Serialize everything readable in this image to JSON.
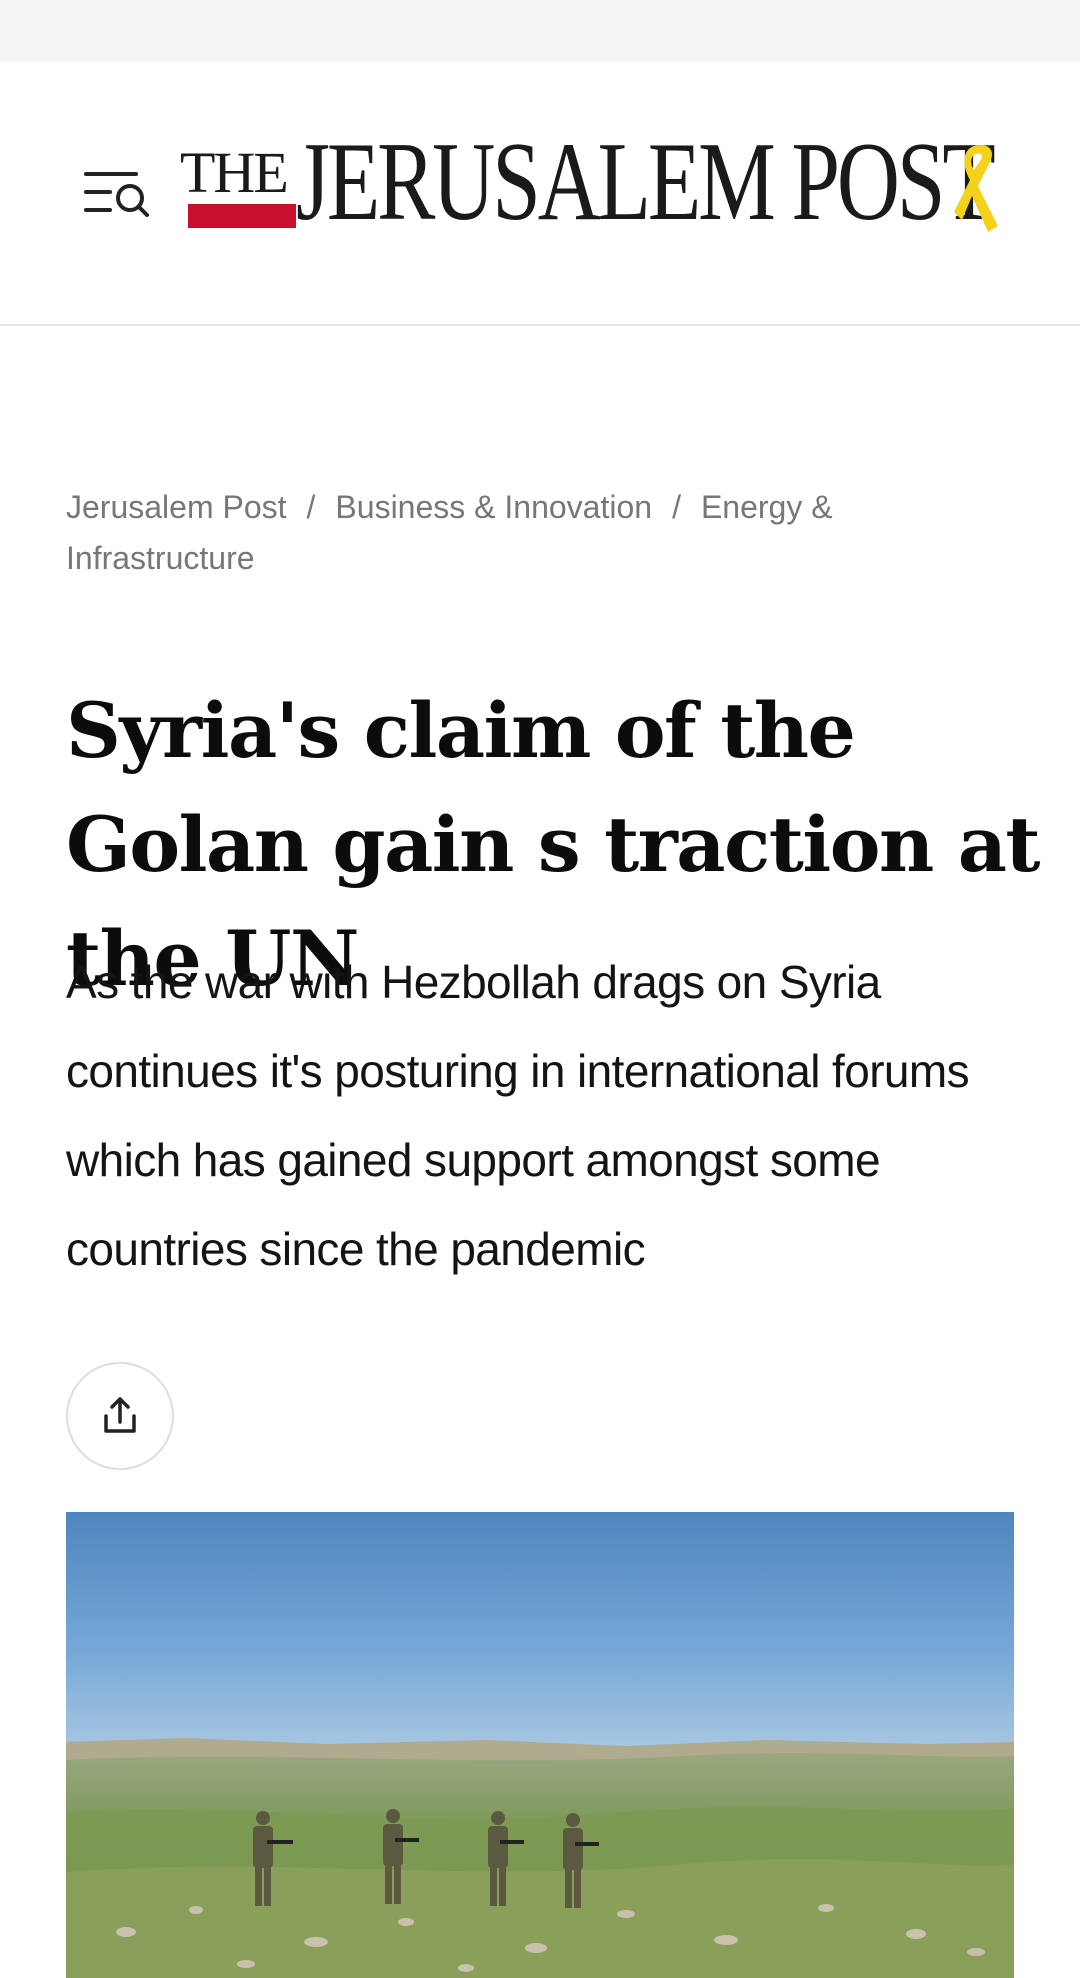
{
  "logo": {
    "the": "THE",
    "name": "JERUSALEM POST"
  },
  "breadcrumb": {
    "items": [
      "Jerusalem Post",
      "Business & Innovation",
      "Energy & Infrastructure"
    ],
    "separator": "/"
  },
  "article": {
    "headline": "Syria's claim of the Golan gain s traction at the UN",
    "subheadline": "As the war with Hezbollah drags on Syria continues it's posturing in international forums which has gained support amongst some countries since the pandemic"
  },
  "icons": {
    "menu": "menu-search-icon",
    "share": "share-icon",
    "ribbon": "yellow-ribbon-icon"
  },
  "colors": {
    "brand_red": "#c8102e",
    "ribbon_yellow": "#f2d21b",
    "breadcrumb_text": "#777777",
    "sky": "#5b8fc6"
  }
}
